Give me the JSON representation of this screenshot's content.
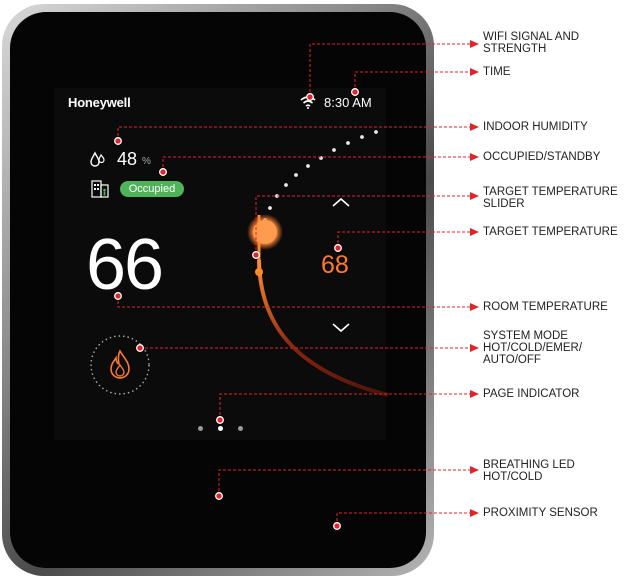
{
  "screen": {
    "brand": "Honeywell",
    "time": "8:30 AM",
    "humidity_value": "48",
    "humidity_unit": "%",
    "occupancy_status": "Occupied",
    "room_temperature": "66",
    "target_temperature": "68",
    "current_page": 2,
    "page_count": 3
  },
  "callouts": [
    {
      "lines": [
        "WiFi SIGNAL AND",
        "STRENGTH"
      ]
    },
    {
      "lines": [
        "TIME"
      ]
    },
    {
      "lines": [
        "INDOOR HUMIDITY"
      ]
    },
    {
      "lines": [
        "OCCUPIED/STANDBY"
      ]
    },
    {
      "lines": [
        "TARGET TEMPERATURE",
        "SLIDER"
      ]
    },
    {
      "lines": [
        "TARGET TEMPERATURE"
      ]
    },
    {
      "lines": [
        "ROOM TEMPERATURE"
      ]
    },
    {
      "lines": [
        "SYSTEM MODE",
        "HOT/COLD/EMER/",
        "AUTO/OFF"
      ]
    },
    {
      "lines": [
        "PAGE INDICATOR"
      ]
    },
    {
      "lines": [
        "BREATHING LED",
        "HOT/COLD"
      ]
    },
    {
      "lines": [
        "PROXIMITY SENSOR"
      ]
    }
  ],
  "icons": {
    "wifi": "wifi-icon",
    "humidity": "droplet-icon",
    "building": "building-icon",
    "mode": "flame-icon",
    "up": "chevron-up-icon",
    "down": "chevron-down-icon"
  },
  "colors": {
    "accent_heat": "#ff7a2c",
    "occupied_badge": "#4fb35a",
    "callout_line": "#e0242b"
  }
}
